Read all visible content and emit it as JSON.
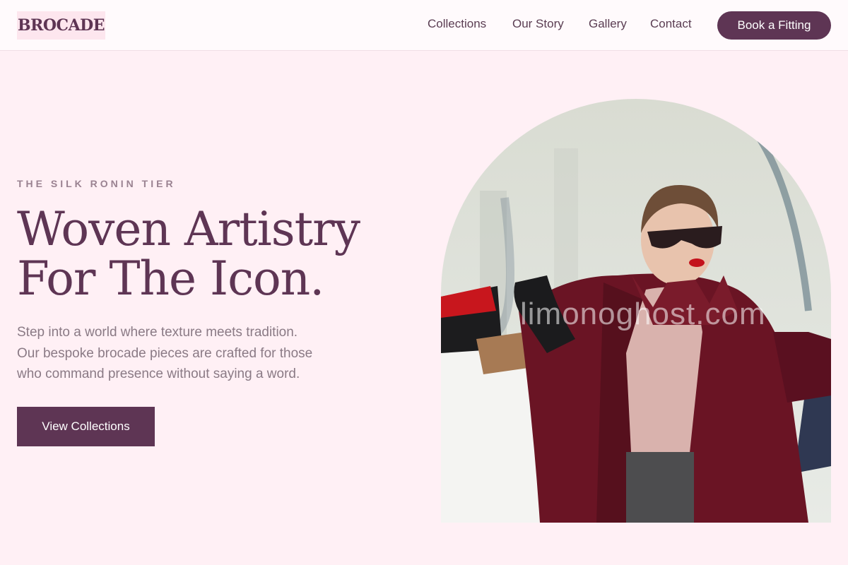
{
  "brand": {
    "logo_text": "BROCADE"
  },
  "nav": {
    "items": [
      {
        "label": "Collections"
      },
      {
        "label": "Our Story"
      },
      {
        "label": "Gallery"
      },
      {
        "label": "Contact"
      }
    ],
    "cta_label": "Book a Fitting"
  },
  "hero": {
    "eyebrow": "THE SILK RONIN TIER",
    "headline_line1": "Woven Artistry",
    "headline_line2": "For The Icon.",
    "lead_line1": "Step into a world where texture meets tradition.",
    "lead_line2": "Our bespoke brocade pieces are crafted for those",
    "lead_line3": "who command presence without saying a word.",
    "button_label": "View Collections"
  },
  "image": {
    "subject": "woman-with-shopping-bags",
    "watermark": "limonoghost.com"
  },
  "colors": {
    "brand_plum": "#5e3554",
    "page_background": "#fff0f5",
    "logo_background": "#fde6ee",
    "muted_text": "#8a7a85"
  }
}
